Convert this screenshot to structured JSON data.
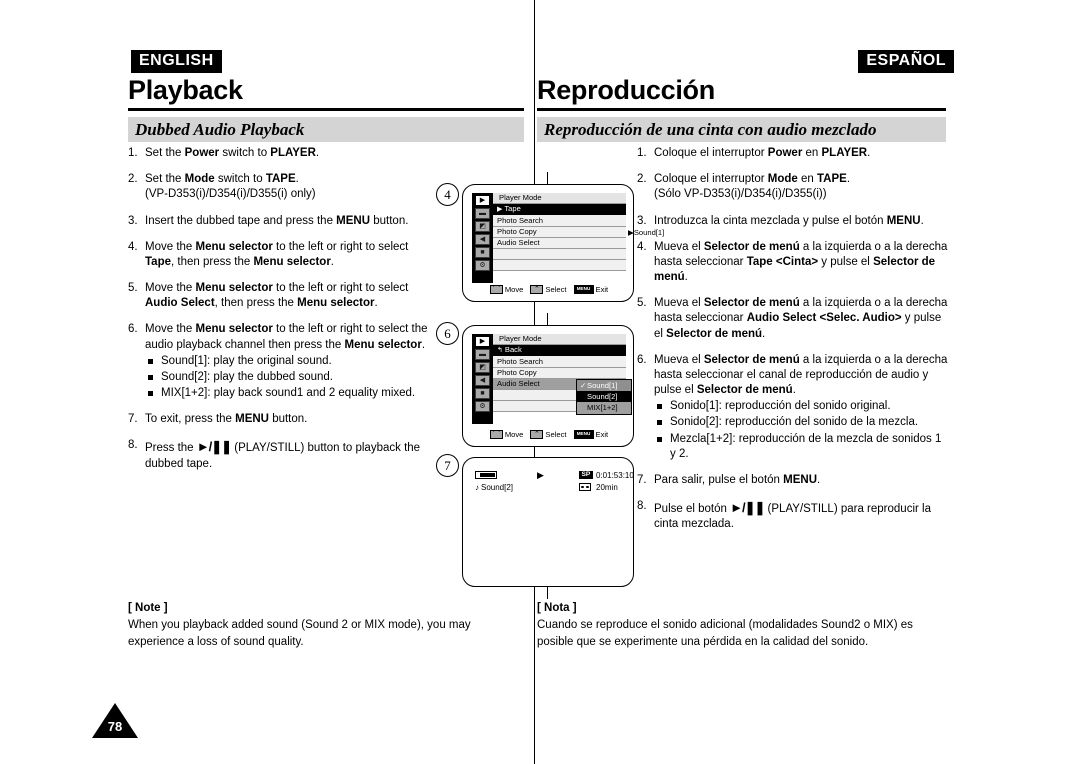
{
  "page": {
    "number": "78",
    "english_badge": "ENGLISH",
    "spanish_badge": "ESPAÑOL"
  },
  "english": {
    "chapter_title": "Playback",
    "section_title": "Dubbed Audio Playback",
    "steps": [
      {
        "num": "1.",
        "html": "Set the <b>Power</b> switch to <b>PLAYER</b>."
      },
      {
        "num": "2.",
        "html": "Set the <b>Mode</b> switch to <b>TAPE</b>.<br>(VP-D353(i)/D354(i)/D355(i) only)"
      },
      {
        "num": "3.",
        "html": "Insert the dubbed tape and press the <b>MENU</b> button."
      },
      {
        "num": "4.",
        "html": "Move the <b>Menu selector</b> to the left or right to select <b>Tape</b>, then press the <b>Menu selector</b>."
      },
      {
        "num": "5.",
        "html": "Move the <b>Menu selector</b> to the left or right to select <b>Audio Select</b>, then press the <b>Menu selector</b>."
      },
      {
        "num": "6.",
        "html": "Move the <b>Menu selector</b> to the left or right to select the audio playback channel then press the <b>Menu selector</b>.",
        "bullets": [
          "Sound[1]: play the original sound.",
          "Sound[2]: play the dubbed sound.",
          "MIX[1+2]: play back sound1 and 2 equality mixed."
        ]
      },
      {
        "num": "7.",
        "html": "To exit, press the <b>MENU</b> button."
      },
      {
        "num": "8.",
        "html": "Press the <span class=\"playstill\">&#9658;/&#10074;&#10074;</span> (PLAY/STILL) button to playback the dubbed tape."
      }
    ],
    "note_head": "[ Note ]",
    "note_body": "When you playback added sound (Sound 2 or MIX mode), you may experience a loss of sound quality."
  },
  "spanish": {
    "chapter_title": "Reproducción",
    "section_title": "Reproducción de una cinta con audio mezclado",
    "steps": [
      {
        "num": "1.",
        "html": "Coloque el interruptor <b>Power</b> en <b>PLAYER</b>."
      },
      {
        "num": "2.",
        "html": "Coloque el interruptor <b>Mode</b> en <b>TAPE</b>.<br>(Sólo VP-D353(i)/D354(i)/D355(i))"
      },
      {
        "num": "3.",
        "html": "Introduzca la cinta mezclada y pulse el botón <b>MENU</b>."
      },
      {
        "num": "4.",
        "html": "Mueva el <b>Selector de menú</b> a la izquierda o a la derecha hasta seleccionar <b>Tape &lt;Cinta&gt;</b> y pulse el <b>Selector de menú</b>."
      },
      {
        "num": "5.",
        "html": "Mueva el <b>Selector de menú</b> a la izquierda o a la derecha hasta seleccionar <b>Audio Select &lt;Selec. Audio&gt;</b> y pulse el <b>Selector de menú</b>."
      },
      {
        "num": "6.",
        "html": "Mueva el <b>Selector de menú</b> a la izquierda o a la derecha hasta seleccionar el canal de reproducción de audio y pulse el <b>Selector de menú</b>.",
        "bullets": [
          "Sonido[1]: reproducción del sonido original.",
          "Sonido[2]: reproducción del sonido de la mezcla.",
          "Mezcla[1+2]: reproducción de la mezcla de sonidos 1 y 2."
        ]
      },
      {
        "num": "7.",
        "html": "Para salir, pulse el botón <b>MENU</b>."
      },
      {
        "num": "8.",
        "html": "Pulse el botón <span class=\"playstill\">&#9658;/&#10074;&#10074;</span> (PLAY/STILL) para reproducir la cinta mezclada."
      }
    ],
    "note_head": "[ Nota ]",
    "note_body": "Cuando se reproduce el sonido adicional (modalidades Sound2 o MIX) es posible que se experimente una pérdida en la calidad del sonido."
  },
  "figures": {
    "step_markers": [
      "4",
      "6",
      "7"
    ],
    "lcd1": {
      "header": "Player Mode",
      "rows": [
        {
          "label": "Tape",
          "cursor": "▶",
          "state": "selected"
        },
        {
          "label": "Photo Search",
          "state": "normal"
        },
        {
          "label": "Photo Copy",
          "state": "normal"
        },
        {
          "label": "Audio Select",
          "state": "normal"
        },
        {
          "label": "",
          "state": "blank"
        },
        {
          "label": "",
          "state": "blank"
        }
      ],
      "value": "▶Sound[1]",
      "rail_icons": [
        "camcorder-icon",
        "display-icon",
        "photo-icon",
        "speaker-icon",
        "memory-icon",
        "settings-icon"
      ],
      "hints": [
        {
          "key": "⌒",
          "label": "Move"
        },
        {
          "key": "⌃",
          "label": "Select"
        },
        {
          "key": "MENU",
          "label": "Exit"
        }
      ]
    },
    "lcd2": {
      "header": "Player Mode",
      "rows": [
        {
          "label": "Back",
          "cursor": "↰",
          "state": "selected"
        },
        {
          "label": "Photo Search",
          "state": "normal"
        },
        {
          "label": "Photo Copy",
          "state": "normal"
        },
        {
          "label": "Audio Select",
          "state": "grey"
        },
        {
          "label": "",
          "state": "blank"
        },
        {
          "label": "",
          "state": "blank"
        }
      ],
      "submenu": [
        {
          "label": "Sound[1]",
          "check": "✓",
          "state": "on"
        },
        {
          "label": "Sound[2]",
          "state": "hl"
        },
        {
          "label": "MIX[1+2]",
          "state": "off"
        }
      ],
      "rail_icons": [
        "camcorder-icon",
        "display-icon",
        "photo-icon",
        "speaker-icon",
        "memory-icon",
        "settings-icon"
      ],
      "hints": [
        {
          "key": "⌒",
          "label": "Move"
        },
        {
          "key": "⌃",
          "label": "Select"
        },
        {
          "key": "MENU",
          "label": "Exit"
        }
      ]
    },
    "lcd3": {
      "battery": "battery-icon",
      "play_glyph": "▶",
      "sp_badge": "SP",
      "timecode": "0:01:53:10",
      "audio_mode": "Sound[2]",
      "tape_remaining": "20min"
    }
  }
}
